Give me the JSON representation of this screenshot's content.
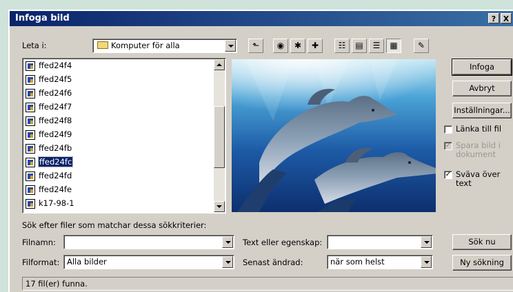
{
  "window": {
    "title": "Infoga bild",
    "help_button": "?",
    "close_button": "X"
  },
  "look_in": {
    "label": "Leta i:",
    "value": "Komputer för alla"
  },
  "toolbar": {
    "icons": [
      "up-folder-icon",
      "search-web-icon",
      "add-favorites-icon",
      "new-folder-icon",
      "list-view-icon",
      "details-view-icon",
      "properties-view-icon",
      "preview-view-icon",
      "tools-icon"
    ]
  },
  "files": {
    "items": [
      {
        "name": "ffed24f4",
        "selected": false
      },
      {
        "name": "ffed24f5",
        "selected": false
      },
      {
        "name": "ffed24f6",
        "selected": false
      },
      {
        "name": "ffed24f7",
        "selected": false
      },
      {
        "name": "ffed24f8",
        "selected": false
      },
      {
        "name": "ffed24f9",
        "selected": false
      },
      {
        "name": "ffed24fb",
        "selected": false
      },
      {
        "name": "ffed24fc",
        "selected": true
      },
      {
        "name": "ffed24fd",
        "selected": false
      },
      {
        "name": "ffed24fe",
        "selected": false
      },
      {
        "name": "k17-98-1",
        "selected": false
      }
    ]
  },
  "buttons": {
    "insert": "Infoga",
    "cancel": "Avbryt",
    "settings": "Inställningar...",
    "search_now": "Sök nu",
    "new_search": "Ny sökning"
  },
  "options": {
    "link_to_file": {
      "label": "Länka till fil",
      "checked": false
    },
    "save_with_doc": {
      "label": "Spara bild i dokument",
      "checked": true,
      "disabled": true
    },
    "float_over_text": {
      "label": "Sväva över text",
      "checked": true
    }
  },
  "search": {
    "heading": "Sök efter filer som matchar dessa sökkriterier:",
    "filename_label": "Filnamn:",
    "filename_value": "",
    "filetype_label": "Filformat:",
    "filetype_value": "Alla bilder",
    "text_label": "Text eller egenskap:",
    "text_value": "",
    "modified_label": "Senast ändrad:",
    "modified_value": "när som helst"
  },
  "status": {
    "text": "17 fil(er) funna."
  },
  "colors": {
    "titlebar_start": "#0a246a",
    "titlebar_end": "#3a6ea5",
    "dialog_face": "#d4d0c8",
    "selection": "#0a246a"
  }
}
